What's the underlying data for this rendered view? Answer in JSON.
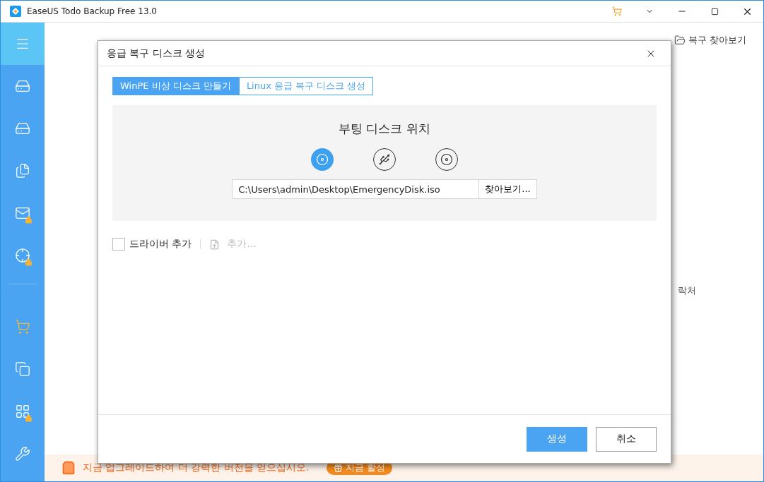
{
  "window": {
    "title": "EaseUS Todo Backup Free 13.0"
  },
  "sidebar": {
    "items": [
      {
        "locked": false
      },
      {
        "locked": false
      },
      {
        "locked": false
      },
      {
        "locked": true
      },
      {
        "locked": true
      }
    ],
    "lower_items": [
      {
        "locked": false
      },
      {
        "locked": false
      },
      {
        "locked": true
      },
      {
        "locked": false
      }
    ]
  },
  "background": {
    "browse_recovery": "복구 찾아보기",
    "contact": "락처"
  },
  "dialog": {
    "title": "응급 복구 디스크 생성",
    "tabs": [
      {
        "label": "WinPE 비상 디스크 만들기",
        "selected": true
      },
      {
        "label": "Linux 응급 복구 디스크 생성",
        "selected": false
      }
    ],
    "heading": "부팅 디스크 위치",
    "targets": [
      {
        "selected": true
      },
      {
        "selected": false
      },
      {
        "selected": false
      }
    ],
    "path": "C:\\Users\\admin\\Desktop\\EmergencyDisk.iso",
    "browse_button": "찾아보기...",
    "driver": {
      "label": "드라이버 추가",
      "checked": false
    },
    "add_button": {
      "label": "추가...",
      "disabled": true
    },
    "buttons": [
      {
        "label": "생성",
        "primary": true
      },
      {
        "label": "취소",
        "primary": false
      }
    ]
  },
  "upgrade_bar": {
    "message": "지금 업그레이드하여 더 강력한 버전을 얻으십시오.",
    "button": "지금 활성"
  }
}
